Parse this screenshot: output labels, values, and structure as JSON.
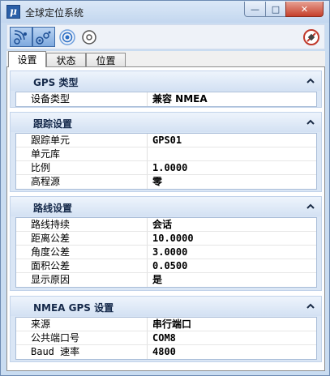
{
  "window": {
    "title": "全球定位系统",
    "app_icon": "μ"
  },
  "title_buttons": {
    "minimize": "—",
    "maximize": "□",
    "close": "✕"
  },
  "toolbar": {
    "icons": [
      "gps-connect-icon",
      "gps-connect-alt-icon",
      "signal-wave-icon",
      "target-icon",
      "disconnect-icon"
    ]
  },
  "tabs": [
    {
      "label": "设置",
      "active": true
    },
    {
      "label": "状态",
      "active": false
    },
    {
      "label": "位置",
      "active": false
    }
  ],
  "sections": [
    {
      "title": "GPS 类型",
      "rows": [
        {
          "label": "设备类型",
          "value": "兼容 NMEA"
        }
      ]
    },
    {
      "title": "跟踪设置",
      "rows": [
        {
          "label": "跟踪单元",
          "value": "GPS01"
        },
        {
          "label": "单元库",
          "value": ""
        },
        {
          "label": "比例",
          "value": "1.0000"
        },
        {
          "label": "高程源",
          "value": "零"
        }
      ]
    },
    {
      "title": "路线设置",
      "rows": [
        {
          "label": "路线持续",
          "value": "会话"
        },
        {
          "label": "距离公差",
          "value": "10.0000"
        },
        {
          "label": "角度公差",
          "value": "3.0000"
        },
        {
          "label": "面积公差",
          "value": "0.0500"
        },
        {
          "label": "显示原因",
          "value": "是"
        }
      ]
    },
    {
      "title": "NMEA GPS 设置",
      "rows": [
        {
          "label": "来源",
          "value": "串行端口"
        },
        {
          "label": "公共端口号",
          "value": "COM8"
        },
        {
          "label": "Baud 速率",
          "value": "4800"
        }
      ]
    }
  ],
  "colors": {
    "accent": "#2a5fa8",
    "section_bg": "#dae6f5",
    "close_red": "#c5402b"
  }
}
